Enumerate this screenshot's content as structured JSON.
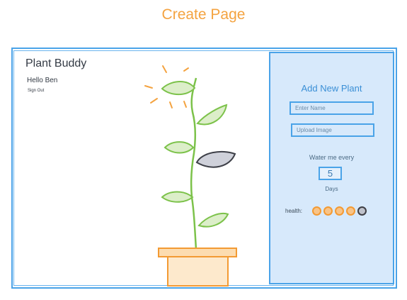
{
  "page": {
    "heading": "Create Page"
  },
  "app": {
    "title": "Plant Buddy",
    "greeting": "Hello Ben",
    "sign_out": "Sign Out"
  },
  "form": {
    "title": "Add New Plant",
    "name_placeholder": "Enter Name",
    "upload_label": "Upload Image",
    "water_label": "Water me every",
    "water_value": "5",
    "days_label": "Days",
    "health_label": "health:",
    "health_rating": 4,
    "health_max": 5
  },
  "colors": {
    "accent_orange": "#f4a340",
    "panel_blue": "#d7e9fb",
    "border_blue": "#4aa3e8",
    "leaf_green": "#7cc24a",
    "leaf_fill": "#dceec9",
    "wilted_leaf": "#cfd1da"
  }
}
